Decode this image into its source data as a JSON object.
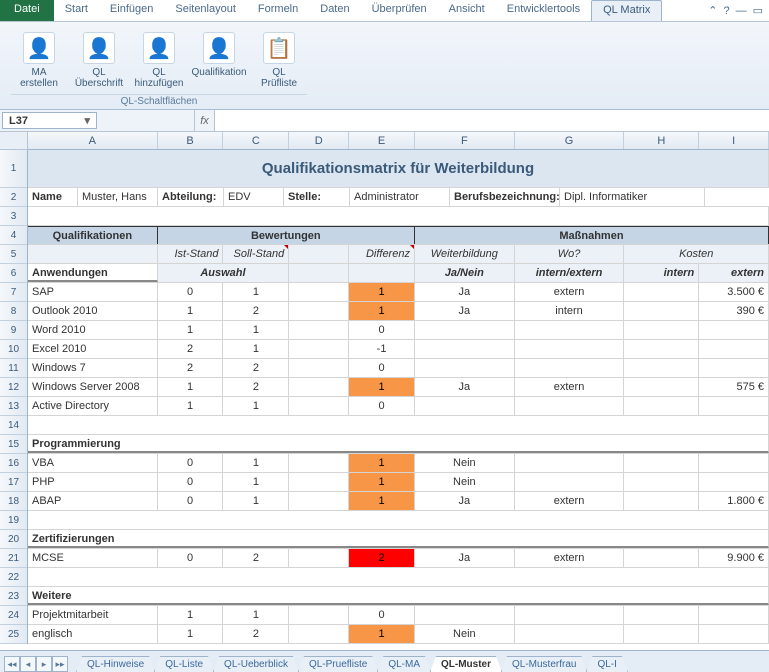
{
  "ribbon": {
    "file": "Datei",
    "tabs": [
      "Start",
      "Einfügen",
      "Seitenlayout",
      "Formeln",
      "Daten",
      "Überprüfen",
      "Ansicht",
      "Entwicklertools",
      "QL Matrix"
    ],
    "active": 8,
    "group_title": "QL-Schaltflächen",
    "buttons": [
      {
        "icon": "👤",
        "label": "MA erstellen"
      },
      {
        "icon": "👤",
        "label": "QL Überschrift"
      },
      {
        "icon": "👤",
        "label": "QL hinzufügen"
      },
      {
        "icon": "👤",
        "label": "Qualifikation"
      },
      {
        "icon": "📋",
        "label": "QL Prüfliste"
      }
    ]
  },
  "namebox": "L37",
  "fx": "fx",
  "columns": [
    "A",
    "B",
    "C",
    "D",
    "E",
    "F",
    "G",
    "H",
    "I"
  ],
  "title": "Qualifikationsmatrix für Weiterbildung",
  "info": {
    "name_label": "Name",
    "name": "Muster, Hans",
    "abt_label": "Abteilung:",
    "abt": "EDV",
    "stelle_label": "Stelle:",
    "stelle": "Administrator",
    "beruf_label": "Berufsbezeichnung:",
    "beruf": "Dipl. Informatiker"
  },
  "sections": {
    "qual": "Qualifikationen",
    "bewert": "Bewertungen",
    "mass": "Maßnahmen",
    "ist": "Ist-Stand",
    "soll": "Soll-Stand",
    "diff": "Differenz",
    "weiter": "Weiterbildung",
    "wo": "Wo?",
    "kosten": "Kosten",
    "anw": "Anwendungen",
    "auswahl": "Auswahl",
    "jn": "Ja/Nein",
    "ie": "intern/extern",
    "int": "intern",
    "ext": "extern"
  },
  "rows": [
    {
      "r": 7,
      "a": "SAP",
      "b": "0",
      "c": "1",
      "d": "",
      "e": "1",
      "ec": "o",
      "f": "Ja",
      "g": "extern",
      "h": "",
      "i": "3.500 €"
    },
    {
      "r": 8,
      "a": "Outlook 2010",
      "b": "1",
      "c": "2",
      "d": "",
      "e": "1",
      "ec": "o",
      "f": "Ja",
      "g": "intern",
      "h": "",
      "i": "390 €"
    },
    {
      "r": 9,
      "a": "Word 2010",
      "b": "1",
      "c": "1",
      "d": "",
      "e": "0",
      "ec": "",
      "f": "",
      "g": "",
      "h": "",
      "i": ""
    },
    {
      "r": 10,
      "a": "Excel 2010",
      "b": "2",
      "c": "1",
      "d": "",
      "e": "-1",
      "ec": "",
      "f": "",
      "g": "",
      "h": "",
      "i": ""
    },
    {
      "r": 11,
      "a": "Windows 7",
      "b": "2",
      "c": "2",
      "d": "",
      "e": "0",
      "ec": "",
      "f": "",
      "g": "",
      "h": "",
      "i": ""
    },
    {
      "r": 12,
      "a": "Windows Server 2008",
      "b": "1",
      "c": "2",
      "d": "",
      "e": "1",
      "ec": "o",
      "f": "Ja",
      "g": "extern",
      "h": "",
      "i": "575 €"
    },
    {
      "r": 13,
      "a": "Active Directory",
      "b": "1",
      "c": "1",
      "d": "",
      "e": "0",
      "ec": "",
      "f": "",
      "g": "",
      "h": "",
      "i": ""
    }
  ],
  "g1": "Programmierung",
  "rows2": [
    {
      "r": 16,
      "a": "VBA",
      "b": "0",
      "c": "1",
      "e": "1",
      "ec": "o",
      "f": "Nein"
    },
    {
      "r": 17,
      "a": "PHP",
      "b": "0",
      "c": "1",
      "e": "1",
      "ec": "o",
      "f": "Nein"
    },
    {
      "r": 18,
      "a": "ABAP",
      "b": "0",
      "c": "1",
      "e": "1",
      "ec": "o",
      "f": "Ja",
      "g": "extern",
      "i": "1.800 €"
    }
  ],
  "g2": "Zertifizierungen",
  "rows3": [
    {
      "r": 21,
      "a": "MCSE",
      "b": "0",
      "c": "2",
      "e": "2",
      "ec": "r",
      "f": "Ja",
      "g": "extern",
      "i": "9.900 €"
    }
  ],
  "g3": "Weitere",
  "rows4": [
    {
      "r": 24,
      "a": "Projektmitarbeit",
      "b": "1",
      "c": "1",
      "e": "0",
      "ec": ""
    },
    {
      "r": 25,
      "a": "englisch",
      "b": "1",
      "c": "2",
      "e": "1",
      "ec": "o",
      "f": "Nein"
    }
  ],
  "sheets": [
    "QL-Hinweise",
    "QL-Liste",
    "QL-Ueberblick",
    "QL-Pruefliste",
    "QL-MA",
    "QL-Muster",
    "QL-Musterfrau",
    "QL-I"
  ],
  "active_sheet": 5
}
